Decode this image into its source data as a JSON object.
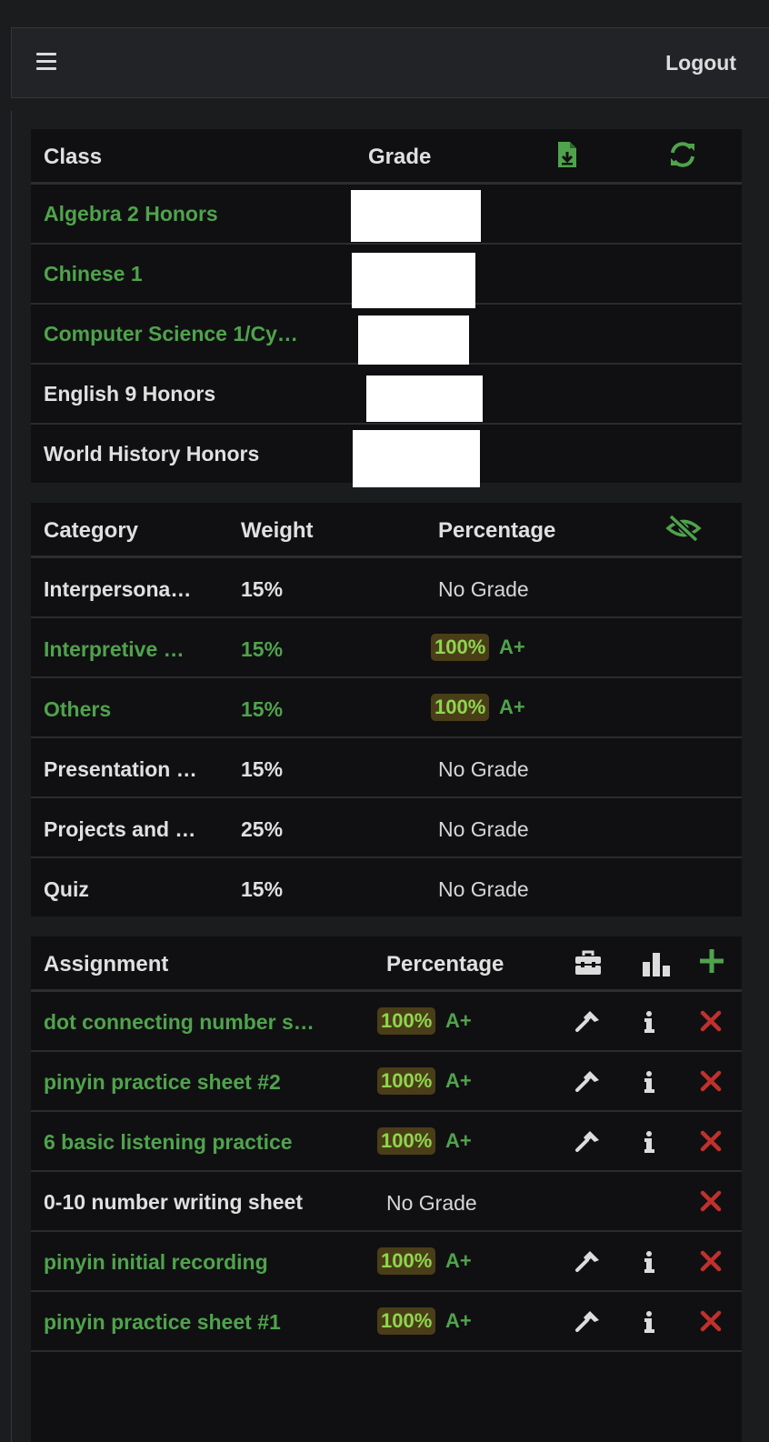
{
  "nav": {
    "logout_label": "Logout",
    "menu_icon": "hamburger-icon"
  },
  "classes_table": {
    "headers": {
      "class": "Class",
      "grade": "Grade",
      "export_icon": "file-download-icon",
      "refresh_icon": "refresh-icon"
    },
    "rows": [
      {
        "name": "Algebra 2 Honors",
        "active": true
      },
      {
        "name": "Chinese 1",
        "active": true
      },
      {
        "name": "Computer Science 1/Cy…",
        "active": true
      },
      {
        "name": "English 9 Honors",
        "active": false
      },
      {
        "name": "World History Honors",
        "active": false
      }
    ]
  },
  "category_table": {
    "headers": {
      "category": "Category",
      "weight": "Weight",
      "percentage": "Percentage",
      "hide_icon": "eye-slash-icon"
    },
    "rows": [
      {
        "category": "Interpersona…",
        "weight": "15%",
        "percent": "",
        "letter": "",
        "no_grade": "No Grade",
        "graded": false
      },
      {
        "category": "Interpretive …",
        "weight": "15%",
        "percent": "100%",
        "letter": "A+",
        "no_grade": "",
        "graded": true
      },
      {
        "category": "Others",
        "weight": "15%",
        "percent": "100%",
        "letter": "A+",
        "no_grade": "",
        "graded": true
      },
      {
        "category": "Presentation …",
        "weight": "15%",
        "percent": "",
        "letter": "",
        "no_grade": "No Grade",
        "graded": false
      },
      {
        "category": "Projects and …",
        "weight": "25%",
        "percent": "",
        "letter": "",
        "no_grade": "No Grade",
        "graded": false
      },
      {
        "category": "Quiz",
        "weight": "15%",
        "percent": "",
        "letter": "",
        "no_grade": "No Grade",
        "graded": false
      }
    ]
  },
  "assignment_table": {
    "headers": {
      "assignment": "Assignment",
      "percentage": "Percentage",
      "toolbox_icon": "toolbox-icon",
      "stats_icon": "bar-chart-icon",
      "add_icon": "plus-icon"
    },
    "rows": [
      {
        "name": "dot connecting number s…",
        "percent": "100%",
        "letter": "A+",
        "no_grade": "",
        "graded": true
      },
      {
        "name": "pinyin practice sheet #2",
        "percent": "100%",
        "letter": "A+",
        "no_grade": "",
        "graded": true
      },
      {
        "name": "6 basic listening practice",
        "percent": "100%",
        "letter": "A+",
        "no_grade": "",
        "graded": true
      },
      {
        "name": "0-10 number writing sheet",
        "percent": "",
        "letter": "",
        "no_grade": "No Grade",
        "graded": false
      },
      {
        "name": "pinyin initial recording",
        "percent": "100%",
        "letter": "A+",
        "no_grade": "",
        "graded": true
      },
      {
        "name": "pinyin practice sheet #1",
        "percent": "100%",
        "letter": "A+",
        "no_grade": "",
        "graded": true
      }
    ]
  },
  "colors": {
    "accent_green": "#4fa34c",
    "delete_red": "#c0302c",
    "badge_bg": "#4a3e18",
    "badge_text": "#8fd64f"
  }
}
